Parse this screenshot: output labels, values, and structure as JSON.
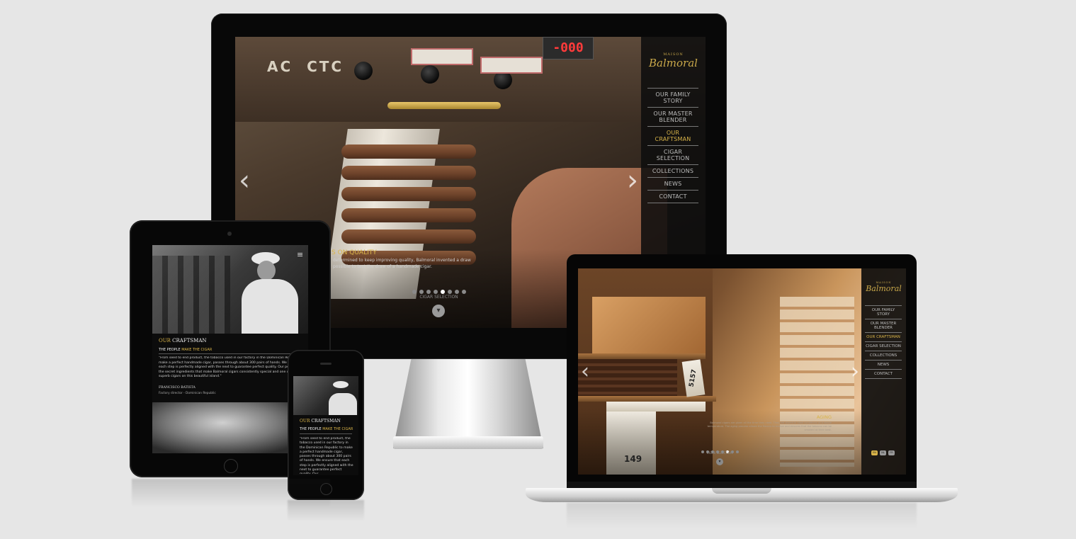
{
  "brand": {
    "logo_small": "MAISON",
    "logo_main": "Balmoral"
  },
  "desktop": {
    "lcd_readout": "-000",
    "nav": [
      "OUR FAMILY STORY",
      "OUR MASTER BLENDER",
      "OUR CRAFTSMAN",
      "CIGAR SELECTION",
      "COLLECTIONS",
      "NEWS",
      "CONTACT"
    ],
    "active_nav": "OUR CRAFTSMAN",
    "caption_title": "S ON QUALITY",
    "caption_text_1": "determined to keep improving quality, Balmoral invented a draw",
    "caption_text_2": "possible to test the draw of a handmade cigar.",
    "slide_count": 8,
    "active_slide": 5,
    "scroll_label": "CIGAR SELECTION",
    "arrow_prev": "‹",
    "arrow_next": "›"
  },
  "tablet": {
    "heading_gold": "OUR",
    "heading_white": "CRAFTSMAN",
    "subheading_white": "THE PEOPLE",
    "subheading_gold": "MAKE THE CIGAR",
    "quote": "\"From seed to end product, the tobacco used in our factory in the Dominican Republic make a perfect handmade cigar, passes through about 300 pairs of hands. We ensure each step is perfectly aligned with the next to guarantee perfect quality. Our people of the secret ingredients that make Balmoral cigars consistently special and one of the superb cigars on this beautiful island.\"",
    "person_name": "FRANCISCO BATISTA",
    "person_role": "Factory director - Dominican Republic",
    "menu_icon": "hamburger-icon"
  },
  "phone": {
    "heading_gold": "OUR",
    "heading_white": "CRAFTSMAN",
    "subheading_white": "THE PEOPLE",
    "subheading_gold": "MAKE THE CIGAR",
    "quote": "\"From seed to end product, the tobacco used in our factory in the Dominican Republic to make a perfect handmade cigar, passes through about 300 pairs of hands. We ensure that each step is perfectly aligned with the next to guarantee perfect quality. Our"
  },
  "laptop": {
    "nav": [
      "OUR FAMILY STORY",
      "OUR MASTER BLENDER",
      "OUR CRAFTSMAN",
      "CIGAR SELECTION",
      "COLLECTIONS",
      "NEWS",
      "CONTACT"
    ],
    "active_nav": "OUR CRAFTSMAN",
    "caption_title": "AGING",
    "caption_text": "Balmoral cigars are given all the time they need. They are stored in ideal conditions at a stable temperature. The aging process allows the flavors to evolve and ensures that the tobacco can be smoked at their best.",
    "slide_count": 8,
    "active_slide": 6,
    "scroll_label": "CIGAR SELECTION",
    "lang_options": [
      "EN",
      "NL",
      "FR"
    ],
    "box_label_1": "5157",
    "box_label_2": "149",
    "arrow_prev": "‹",
    "arrow_next": "›"
  },
  "colors": {
    "accent_gold": "#d9b449",
    "background": "#e6e6e6",
    "device_black": "#070707"
  }
}
